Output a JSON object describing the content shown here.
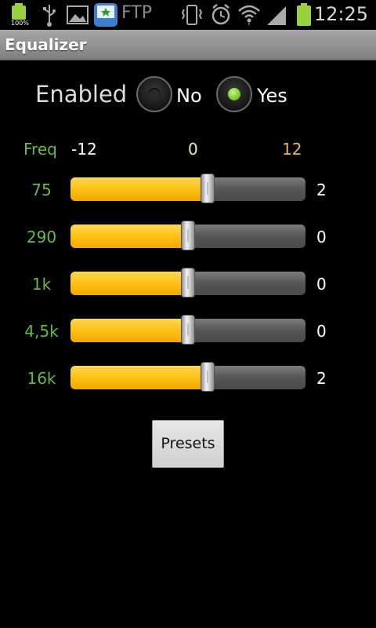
{
  "status_bar": {
    "battery_percent": "100%",
    "ftp_label": "FTP",
    "clock": "12:25",
    "icons": [
      "battery-charging-icon",
      "usb-icon",
      "image-icon",
      "app-icon",
      "ftp-icon",
      "vibrate-icon",
      "alarm-icon",
      "wifi-icon",
      "signal-icon",
      "battery-icon"
    ]
  },
  "title": "Equalizer",
  "enabled": {
    "label": "Enabled",
    "options": [
      {
        "label": "No",
        "selected": false
      },
      {
        "label": "Yes",
        "selected": true
      }
    ]
  },
  "header": {
    "freq_label": "Freq",
    "min": "-12",
    "mid": "0",
    "max": "12",
    "min_color": "#ffffff",
    "mid_color": "#f3f0a0",
    "max_color": "#f0b070"
  },
  "bands": [
    {
      "freq": "75",
      "value": 2,
      "value_label": "2"
    },
    {
      "freq": "290",
      "value": 0,
      "value_label": "0"
    },
    {
      "freq": "1k",
      "value": 0,
      "value_label": "0"
    },
    {
      "freq": "4,5k",
      "value": 0,
      "value_label": "0"
    },
    {
      "freq": "16k",
      "value": 2,
      "value_label": "2"
    }
  ],
  "range": {
    "min": -12,
    "max": 12
  },
  "presets_label": "Presets",
  "colors": {
    "accent_green": "#66bb44",
    "slider_fill": "#ffc21a",
    "radio_selected": "#6fc21e"
  }
}
